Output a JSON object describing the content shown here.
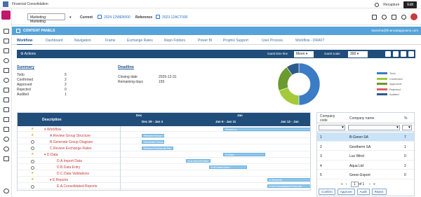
{
  "app": {
    "title": "Financial Consolidation",
    "recapture": "Recapture",
    "edit": "Edit"
  },
  "header": {
    "dimension": "Marketing: Marketing",
    "current_label": "Current",
    "current_value": "2024.12WEB000",
    "reference_label": "Reference",
    "reference_value": "2023.12ACT000"
  },
  "content_panel": {
    "title": "CONTENT PANELS",
    "email": "Manisha@financialappname.com"
  },
  "tabs": [
    "Workflow",
    "Dashboard",
    "Navigation",
    "Frame",
    "Exchange Rates",
    "Repo Folders",
    "Power BI",
    "Prophix Support",
    "User Process",
    "Workflow - DRAFT"
  ],
  "action_bar": {
    "actions": "Actions",
    "gantt_timeline_label": "Gantt time line",
    "gantt_timeline_value": "Moen",
    "gantt_scale_label": "Gantt scale",
    "gantt_scale_value": "300"
  },
  "summary": {
    "title": "Summary",
    "rows": [
      {
        "label": "Todo",
        "value": "5"
      },
      {
        "label": "Confirmed",
        "value": "2"
      },
      {
        "label": "Approved",
        "value": "2"
      },
      {
        "label": "Rejected",
        "value": "0"
      },
      {
        "label": "Audited",
        "value": "1"
      }
    ]
  },
  "deadline": {
    "title": "Deadline",
    "rows": [
      {
        "label": "Closing date",
        "value": "2025-12-31"
      },
      {
        "label": "Remaining days",
        "value": "155"
      }
    ]
  },
  "donut": {
    "segments": [
      {
        "label": "Todo",
        "value": 5,
        "color": "#3b7cc4"
      },
      {
        "label": "Confirmed",
        "value": 2,
        "color": "#a4c93a"
      },
      {
        "label": "Approved",
        "value": 2,
        "color": "#6b9a2e"
      },
      {
        "label": "Rejected",
        "value": 0,
        "color": "#e06060"
      },
      {
        "label": "Audited",
        "value": 1,
        "color": "#2d5a8a"
      }
    ]
  },
  "gantt": {
    "header": {
      "description": "Description",
      "dec": "Dec",
      "jan": "Jan",
      "week1": "Dec 29 - Jan 4",
      "week2": "Jan 5 - Jan 11",
      "week3": "Jan 12 - Jan"
    },
    "rows": [
      {
        "name": "Workflow",
        "icon": "star",
        "bar": "Workflow"
      },
      {
        "name": "A.Review Group Structure",
        "icon": "star",
        "bar": "Review Group Str..."
      },
      {
        "name": "B.Generate Group Diagram",
        "icon": "circle",
        "bar": "Generate Group D..."
      },
      {
        "name": "C.Review Exchange Rates",
        "icon": "circle",
        "bar": "Review Exchange Ra..."
      },
      {
        "name": "D.Data",
        "icon": "star",
        "bar": "D.Data"
      },
      {
        "name": "D.A.Import Data",
        "icon": "circle",
        "bar": "D.A.Import Data"
      },
      {
        "name": "D.B.Data Entry",
        "icon": "circle",
        "bar": "D.B.Data Entry"
      },
      {
        "name": "D.C.Data Validations",
        "icon": "star",
        "bar": ""
      },
      {
        "name": "E.Reports",
        "icon": "star",
        "bar": "E.Reports"
      },
      {
        "name": "E.A.Consolidated Reports",
        "icon": "circle",
        "bar": "E.A.Consolidated Reports"
      }
    ]
  },
  "companies": {
    "headers": {
      "code": "Company code",
      "name": "Company name",
      "pct": "%"
    },
    "rows": [
      {
        "code": "1",
        "name": "B-Green SA",
        "pct": "7"
      },
      {
        "code": "2",
        "name": "Geotherm SA",
        "pct": "1"
      },
      {
        "code": "3",
        "name": "Lux Wind",
        "pct": "0"
      },
      {
        "code": "4",
        "name": "Aqua Ltd",
        "pct": "2"
      },
      {
        "code": "5",
        "name": "Green Export",
        "pct": "0"
      }
    ],
    "pager": {
      "page": "1",
      "of": "of 1"
    },
    "buttons": [
      "Confirm",
      "Approve",
      "Audit",
      "Reject"
    ]
  }
}
